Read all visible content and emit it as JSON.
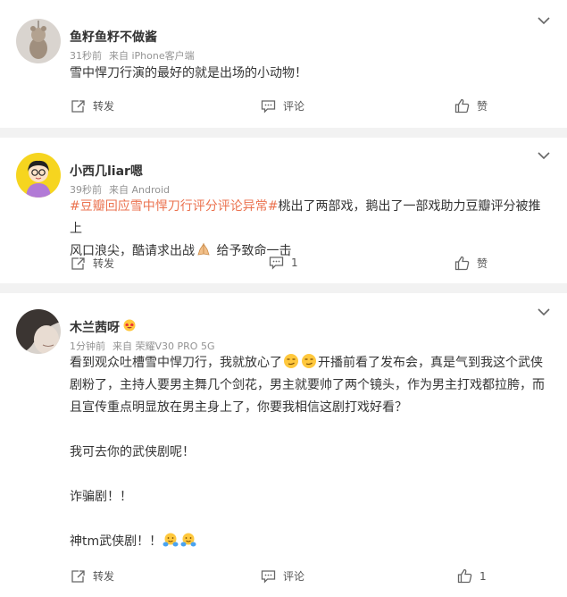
{
  "comments": [
    {
      "username": "鱼籽鱼籽不做酱",
      "time": "31秒前",
      "source": "来自 iPhone客户端",
      "text": "雪中悍刀行演的最好的就是出场的小动物！",
      "actions": {
        "repost": "转发",
        "comment": "评论",
        "like": "赞"
      }
    },
    {
      "username": "小西几liar嗯",
      "time": "39秒前",
      "source": "来自 Android",
      "hashtag": "#豆瓣回应雪中悍刀行评分评论异常#",
      "text_line1_rest": "桃出了两部戏，鹅出了一部戏助力豆瓣评分被推上",
      "text_line2": "风口浪尖，酷请求出战",
      "text_line2_end": " 给予致命一击",
      "actions": {
        "repost": "转发",
        "comment": "1",
        "like": "赞"
      }
    },
    {
      "username": "木兰茜呀",
      "time": "1分钟前",
      "source": "来自 荣耀V30 PRO 5G",
      "line1a": "看到观众吐槽雪中悍刀行，我就放心了",
      "line1b": "开播前看了发布会，真是气到我这个武侠",
      "line2": "剧粉了，主持人要男主舞几个剑花，男主就要帅了两个镜头，作为男主打戏都拉胯，而",
      "line3": "且宣传重点明显放在男主身上了，你要我相信这剧打戏好看？",
      "p2": "我可去你的武侠剧呢！",
      "p3": "诈骗剧！！",
      "p4": "神tm武侠剧！！",
      "actions": {
        "repost": "转发",
        "comment": "评论",
        "like": "1"
      }
    }
  ],
  "colors": {
    "tag": "#eb7350",
    "meta": "#939393",
    "text": "#333333",
    "background": "#f2f2f2"
  }
}
